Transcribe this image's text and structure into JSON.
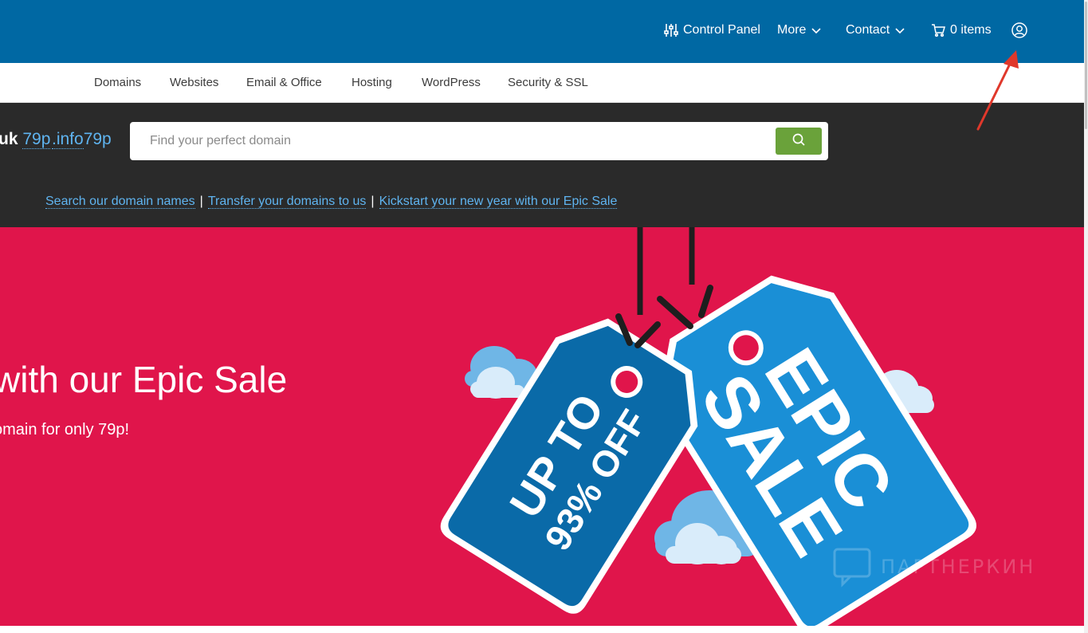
{
  "topnav": {
    "control_panel": "Control Panel",
    "more": "More",
    "contact": "Contact",
    "cart": "0 items",
    "icons": [
      "sliders-icon",
      "chevron-down-icon",
      "cart-icon",
      "user-icon"
    ]
  },
  "mainnav": {
    "items": [
      "Domains",
      "Websites",
      "Email & Office",
      "Hosting",
      "WordPress",
      "Security & SSL"
    ]
  },
  "search": {
    "tld_1_ext": "uk",
    "tld_1_price": "79p",
    "tld_2_ext": ".info",
    "tld_2_price": "79p",
    "placeholder": "Find your perfect domain",
    "links": [
      "Search our domain names",
      "Transfer your domains to us",
      "Kickstart your new year with our Epic Sale"
    ],
    "separator": "|"
  },
  "hero": {
    "title": "with our Epic Sale",
    "subtitle": "omain for only 79p!",
    "tag_left_line1": "UP TO",
    "tag_left_line2": "93% OFF",
    "tag_right_line1": "EPIC",
    "tag_right_line2": "SALE"
  },
  "watermark": "ПАРТНЕРКИН",
  "colors": {
    "topbar": "#0068a3",
    "searchband": "#2a2a2a",
    "link": "#5fb4f0",
    "search_button": "#6aa23a",
    "hero": "#e0154b",
    "tag_dark": "#0a6aa8",
    "tag_light": "#1a8fd6",
    "annotation": "#e0382b"
  }
}
